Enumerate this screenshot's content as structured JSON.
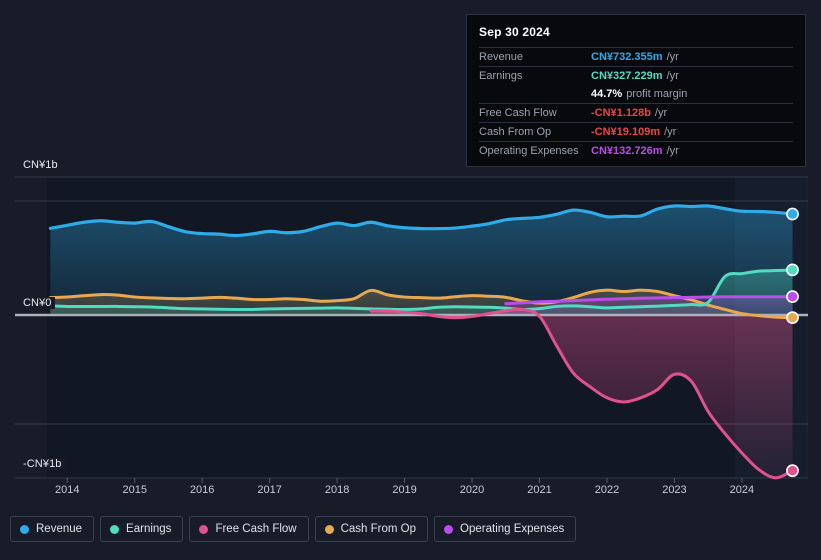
{
  "colors": {
    "revenue": "#2eabe8",
    "earnings": "#4fdcc0",
    "free_cash_flow": "#e0518f",
    "cash_from_op": "#e8a84f",
    "operating_expenses": "#b94fe8",
    "negative": "#ef4444",
    "background": "#171c28",
    "tooltip_bg": "#08090d",
    "grid": "#2b3340"
  },
  "tooltip": {
    "date": "Sep 30 2024",
    "rows": [
      {
        "label": "Revenue",
        "value": "CN¥732.355m",
        "unit": "/yr",
        "color": "#2eabe8"
      },
      {
        "label": "Earnings",
        "value": "CN¥327.229m",
        "unit": "/yr",
        "color": "#4fdcc0"
      },
      {
        "label": "",
        "value": "44.7%",
        "unit": "profit margin",
        "color": "#ffffff",
        "sub": true
      },
      {
        "label": "Free Cash Flow",
        "value": "-CN¥1.128b",
        "unit": "/yr",
        "color": "#ef4444"
      },
      {
        "label": "Cash From Op",
        "value": "-CN¥19.109m",
        "unit": "/yr",
        "color": "#ef4444"
      },
      {
        "label": "Operating Expenses",
        "value": "CN¥132.726m",
        "unit": "/yr",
        "color": "#b94fe8"
      }
    ]
  },
  "legend": [
    {
      "label": "Revenue",
      "color": "#2eabe8"
    },
    {
      "label": "Earnings",
      "color": "#4fdcc0"
    },
    {
      "label": "Free Cash Flow",
      "color": "#e0518f"
    },
    {
      "label": "Cash From Op",
      "color": "#e8a84f"
    },
    {
      "label": "Operating Expenses",
      "color": "#b94fe8"
    }
  ],
  "axis": {
    "y_labels": [
      {
        "text": "CN¥1b",
        "value": 1000000000
      },
      {
        "text": "CN¥0",
        "value": 0
      },
      {
        "text": "-CN¥1b",
        "value": -1000000000
      }
    ],
    "x_labels": [
      "2014",
      "2015",
      "2016",
      "2017",
      "2018",
      "2019",
      "2020",
      "2021",
      "2022",
      "2023",
      "2024"
    ]
  },
  "chart_data": {
    "type": "area",
    "title": "",
    "xlabel": "",
    "ylabel": "CN¥",
    "ylim": [
      -1250000000,
      1150000000
    ],
    "xlim": [
      2013.7,
      2024.95
    ],
    "grid": true,
    "legend_position": "bottom",
    "x": [
      2013.75,
      2014.0,
      2014.25,
      2014.5,
      2014.75,
      2015.0,
      2015.25,
      2015.5,
      2015.75,
      2016.0,
      2016.25,
      2016.5,
      2016.75,
      2017.0,
      2017.25,
      2017.5,
      2017.75,
      2018.0,
      2018.25,
      2018.5,
      2018.75,
      2019.0,
      2019.25,
      2019.5,
      2019.75,
      2020.0,
      2020.25,
      2020.5,
      2020.75,
      2021.0,
      2021.25,
      2021.5,
      2021.75,
      2022.0,
      2022.25,
      2022.5,
      2022.75,
      2023.0,
      2023.25,
      2023.5,
      2023.75,
      2024.0,
      2024.25,
      2024.5,
      2024.75
    ],
    "series": [
      {
        "name": "Revenue",
        "color": "#2eabe8",
        "unit": "CN¥",
        "values": [
          628,
          650,
          672,
          683,
          672,
          666,
          678,
          640,
          604,
          590,
          586,
          576,
          588,
          606,
          596,
          606,
          640,
          666,
          648,
          672,
          646,
          632,
          626,
          626,
          630,
          644,
          662,
          690,
          700,
          708,
          730,
          760,
          744,
          712,
          716,
          718,
          768,
          790,
          786,
          790,
          770,
          752,
          750,
          744,
          732
        ]
      },
      {
        "name": "Earnings",
        "color": "#4fdcc0",
        "unit": "CN¥",
        "values": [
          66,
          62,
          62,
          62,
          62,
          60,
          58,
          52,
          46,
          44,
          42,
          40,
          40,
          44,
          46,
          48,
          50,
          52,
          48,
          44,
          42,
          40,
          44,
          56,
          60,
          58,
          56,
          50,
          40,
          46,
          62,
          66,
          60,
          52,
          56,
          60,
          64,
          70,
          76,
          92,
          280,
          300,
          318,
          322,
          327
        ]
      },
      {
        "name": "Free Cash Flow",
        "color": "#e0518f",
        "unit": "CN¥",
        "values": [
          null,
          null,
          null,
          null,
          null,
          null,
          null,
          null,
          null,
          null,
          null,
          null,
          null,
          null,
          null,
          null,
          null,
          null,
          null,
          30,
          28,
          20,
          10,
          -10,
          -20,
          -10,
          10,
          30,
          40,
          -10,
          -220,
          -420,
          -520,
          -600,
          -630,
          -600,
          -540,
          -430,
          -480,
          -700,
          -860,
          -1000,
          -1120,
          -1180,
          -1128
        ]
      },
      {
        "name": "Cash From Op",
        "color": "#e8a84f",
        "unit": "CN¥",
        "values": [
          126,
          130,
          140,
          148,
          144,
          130,
          124,
          120,
          118,
          122,
          128,
          122,
          112,
          112,
          118,
          112,
          100,
          104,
          118,
          178,
          146,
          130,
          126,
          122,
          132,
          140,
          136,
          128,
          102,
          86,
          96,
          126,
          164,
          180,
          170,
          180,
          170,
          140,
          110,
          72,
          40,
          10,
          -5,
          -15,
          -19
        ]
      },
      {
        "name": "Operating Expenses",
        "color": "#b94fe8",
        "unit": "CN¥",
        "values": [
          null,
          null,
          null,
          null,
          null,
          null,
          null,
          null,
          null,
          null,
          null,
          null,
          null,
          null,
          null,
          null,
          null,
          null,
          null,
          null,
          null,
          null,
          null,
          null,
          null,
          null,
          null,
          82,
          88,
          96,
          100,
          104,
          110,
          114,
          118,
          122,
          124,
          126,
          128,
          130,
          132,
          132,
          132,
          132,
          133
        ]
      }
    ],
    "latest_point": {
      "date": "Sep 30 2024",
      "revenue": 732355000,
      "earnings": 327229000,
      "profit_margin_pct": 44.7,
      "free_cash_flow": -1128000000,
      "cash_from_op": -19109000,
      "operating_expenses": 132726000
    }
  }
}
